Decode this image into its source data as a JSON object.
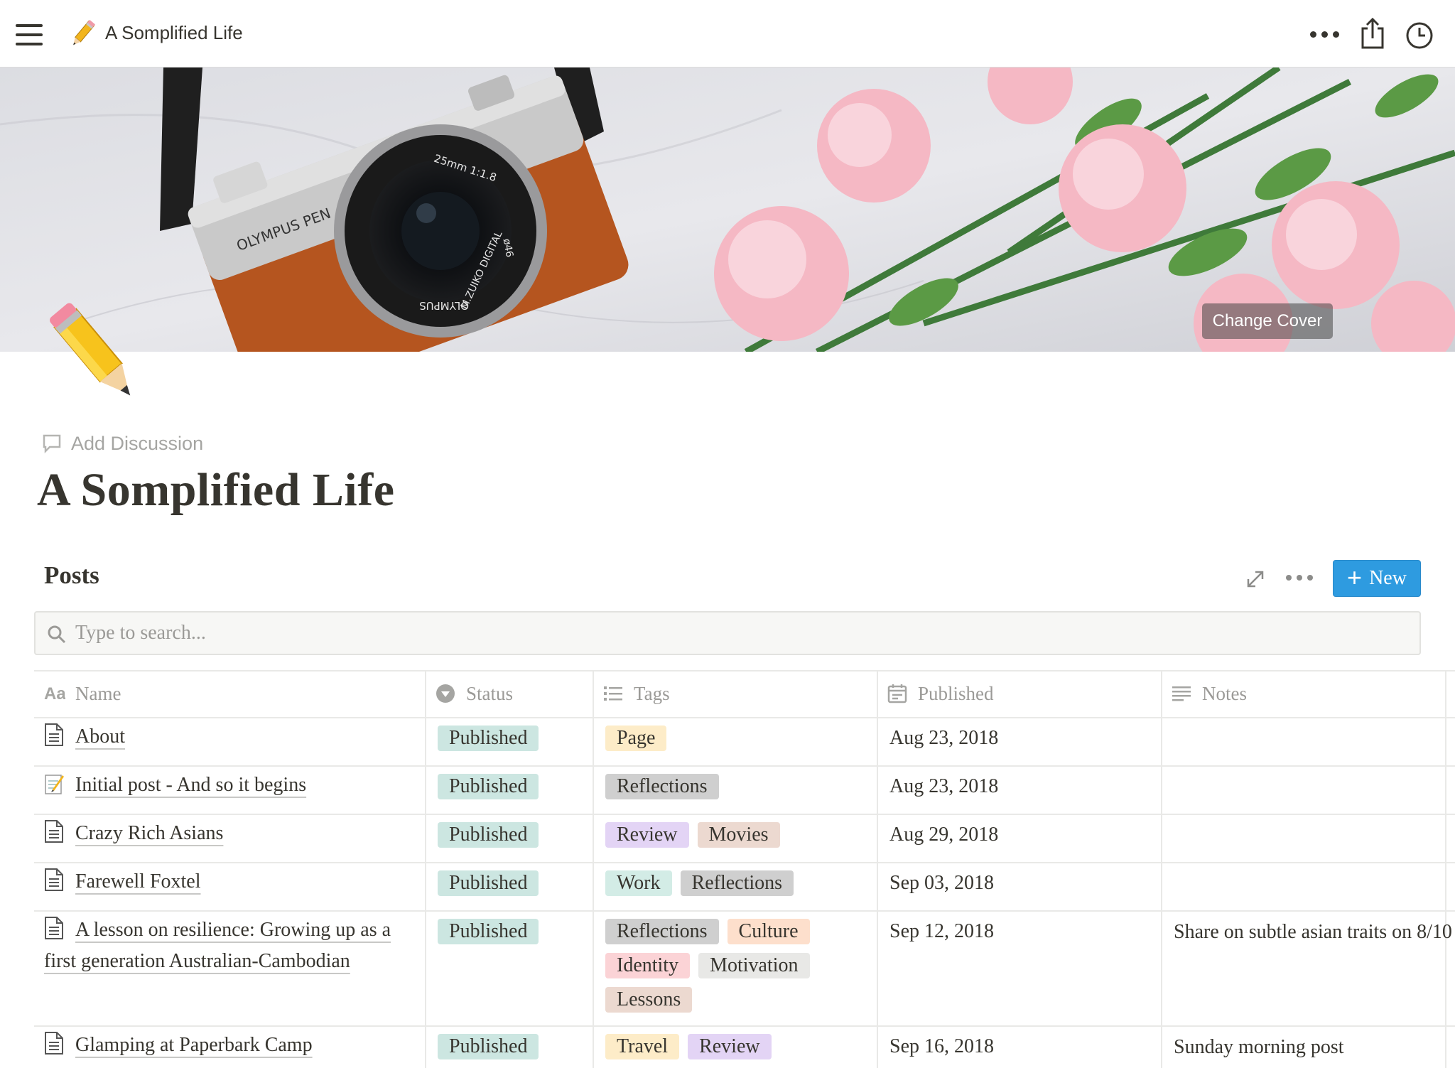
{
  "topbar": {
    "title": "A Somplified Life",
    "menu_icon": "hamburger-icon",
    "page_emoji": "pencil-icon",
    "more_icon": "more-horizontal-icon",
    "share_icon": "share-icon",
    "history_icon": "clock-icon"
  },
  "cover": {
    "change_label": "Change Cover",
    "camera_text": [
      "OLYMPUS PEN",
      "25mm 1:1.8",
      "M.ZUIKO DIGITAL",
      "ø46",
      "OLYMPUS"
    ]
  },
  "page": {
    "icon": "pencil-icon",
    "add_discussion": "Add Discussion",
    "title": "A Somplified Life"
  },
  "database": {
    "title": "Posts",
    "new_label": "New",
    "search_placeholder": "Type to search...",
    "columns": [
      "Name",
      "Status",
      "Tags",
      "Published",
      "Notes"
    ],
    "rows": [
      {
        "name": "About",
        "status": "Published",
        "tags": [
          "Page"
        ],
        "published": "Aug 23, 2018",
        "notes": "",
        "icon": "document-icon"
      },
      {
        "name": "Initial post - And so it begins",
        "status": "Published",
        "tags": [
          "Reflections"
        ],
        "published": "Aug 23, 2018",
        "notes": "",
        "icon": "memo-icon"
      },
      {
        "name": "Crazy Rich Asians",
        "status": "Published",
        "tags": [
          "Review",
          "Movies"
        ],
        "published": "Aug 29, 2018",
        "notes": "",
        "icon": "document-icon"
      },
      {
        "name": "Farewell Foxtel",
        "status": "Published",
        "tags": [
          "Work",
          "Reflections"
        ],
        "published": "Sep 03, 2018",
        "notes": "",
        "icon": "document-icon"
      },
      {
        "name": "A lesson on resilience: Growing up as a first generation Australian-Cambodian",
        "status": "Published",
        "tags": [
          "Reflections",
          "Culture",
          "Identity",
          "Motivation",
          "Lessons"
        ],
        "published": "Sep 12, 2018",
        "notes": "Share on subtle asian traits on 8/10",
        "icon": "document-icon"
      },
      {
        "name": "Glamping at Paperbark Camp",
        "status": "Published",
        "tags": [
          "Travel",
          "Review"
        ],
        "published": "Sep 16, 2018",
        "notes": "Sunday morning post",
        "icon": "document-icon"
      }
    ]
  },
  "colors": {
    "status_published_bg": "#cce6e1",
    "tag_colors": {
      "Page": "#fdecc8",
      "Reflections": "#cfcfcf",
      "Review": "#e3d4f5",
      "Movies": "#ecd9d0",
      "Work": "#d3ece6",
      "Culture": "#fddfcc",
      "Identity": "#fbd3d6",
      "Motivation": "#e8e8e6",
      "Lessons": "#ecd9d0",
      "Travel": "#fdecc8"
    },
    "new_button": "#2e9be0"
  }
}
